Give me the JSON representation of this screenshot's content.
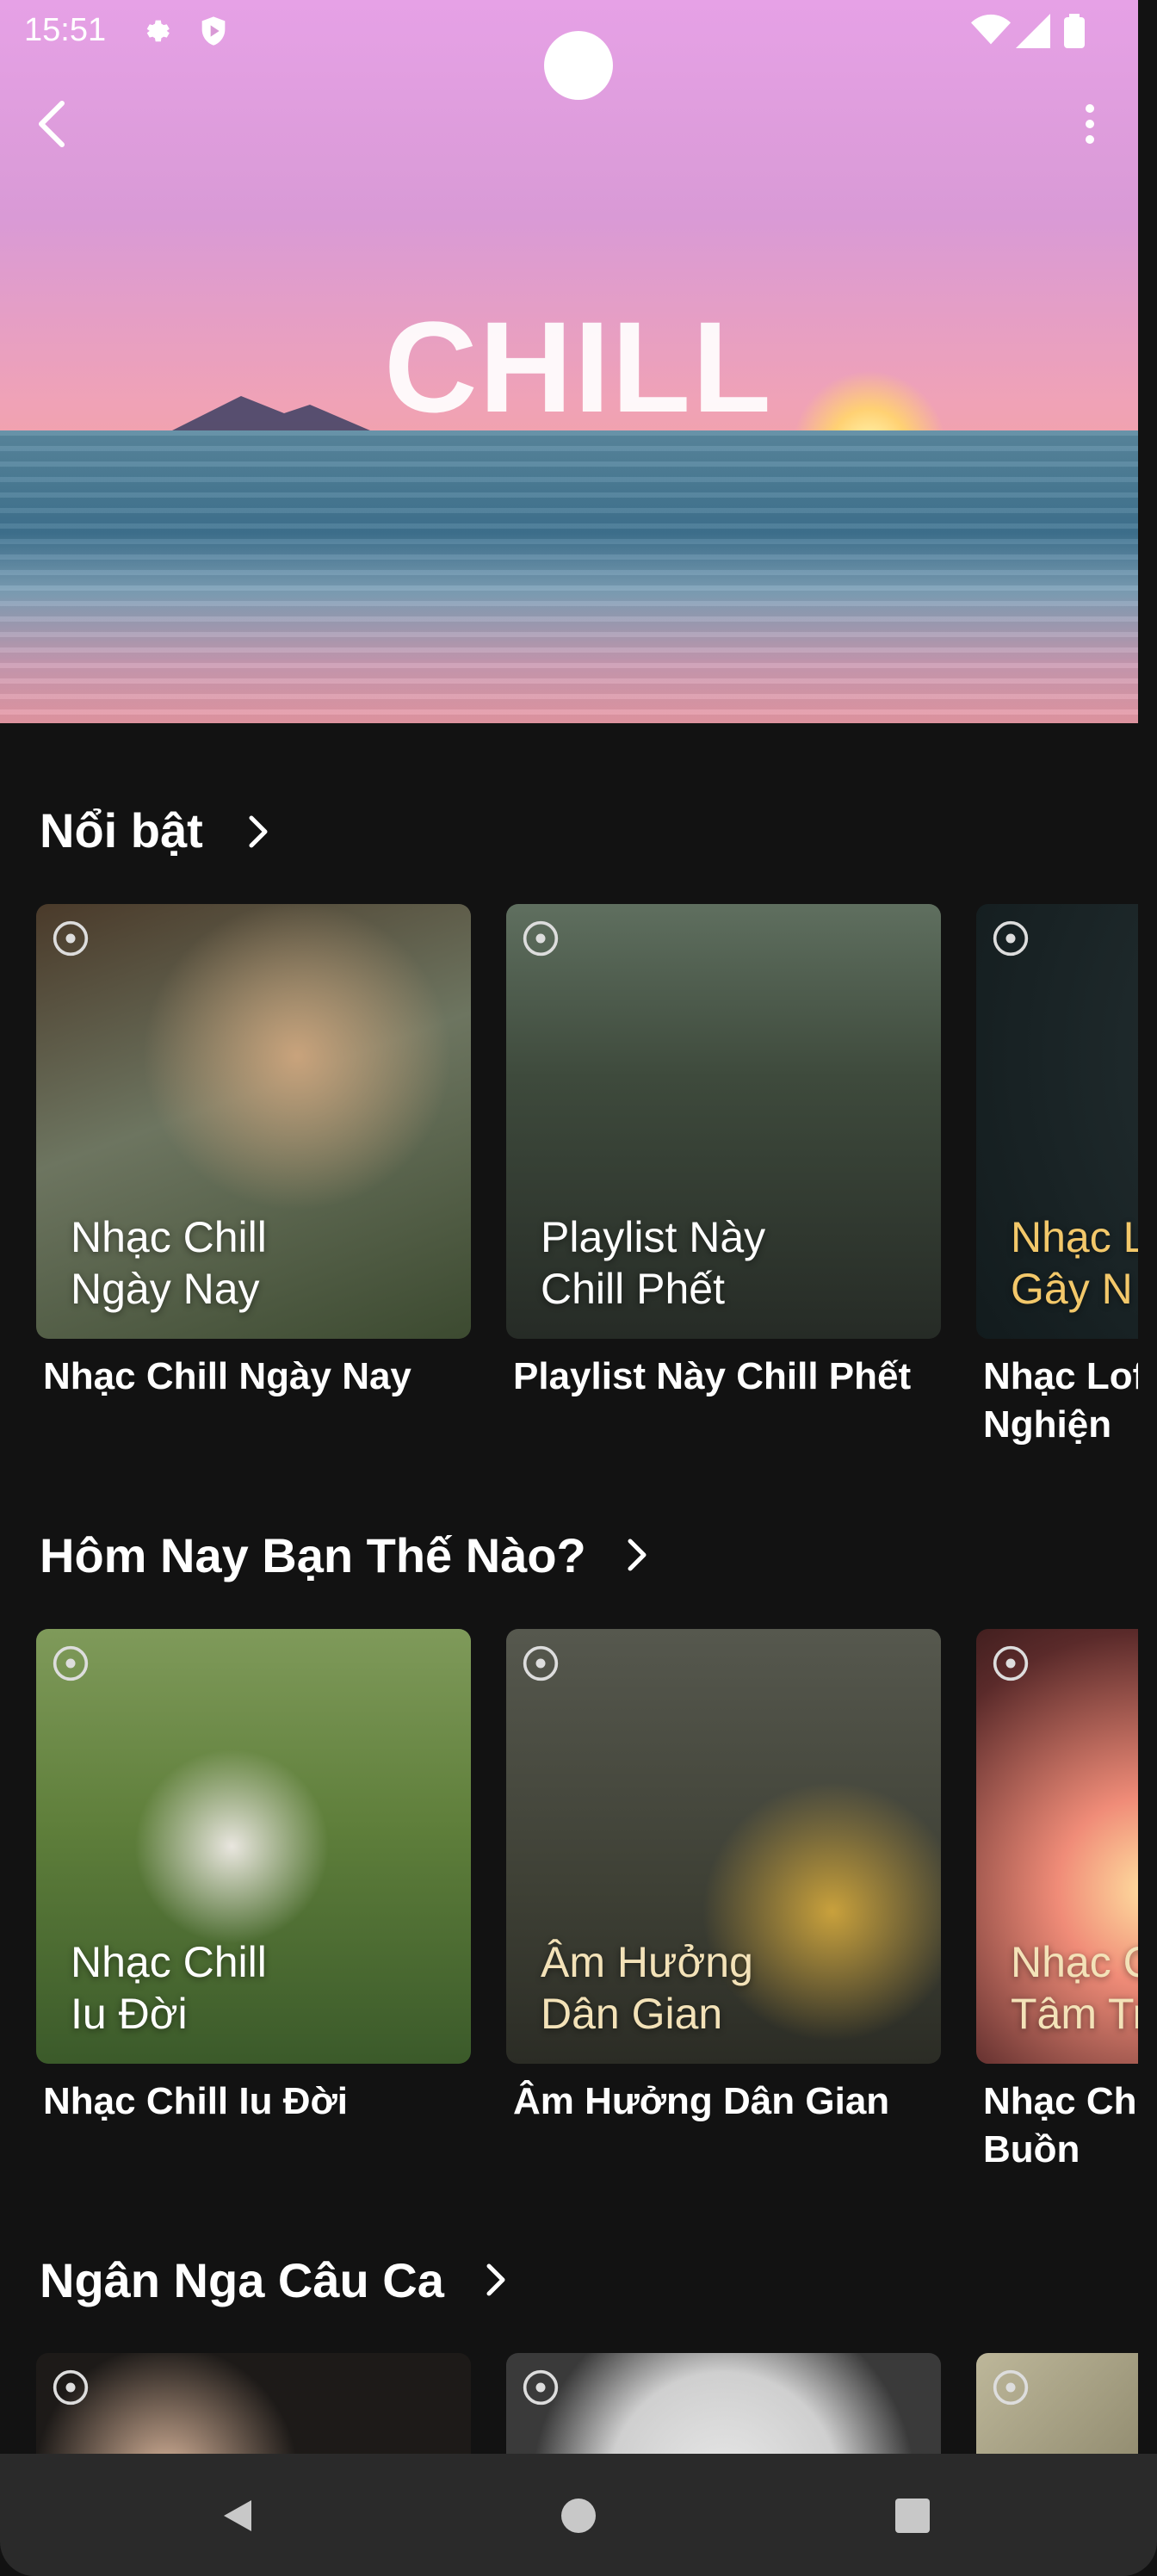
{
  "status_bar": {
    "time": "15:51"
  },
  "hero": {
    "title": "CHILL"
  },
  "sections": [
    {
      "title": "Nổi bật",
      "cards": [
        {
          "title": "Nhạc Chill Ngày Nay",
          "cover_text": [
            "Nhạc Chill",
            "Ngày Nay"
          ]
        },
        {
          "title": "Playlist Này Chill Phết",
          "cover_text": [
            "Playlist Này",
            "Chill Phết"
          ]
        },
        {
          "title": "Nhạc Lof Nghiện",
          "cover_text": [
            "Nhạc L",
            "Gây N"
          ]
        }
      ]
    },
    {
      "title": "Hôm Nay Bạn Thế Nào?",
      "cards": [
        {
          "title": "Nhạc Chill Iu Đời",
          "cover_text": [
            "Nhạc Chill",
            "Iu Đời"
          ]
        },
        {
          "title": "Âm Hưởng Dân Gian",
          "cover_text": [
            "Âm Hưởng",
            "Dân Gian"
          ]
        },
        {
          "title": "Nhạc Chi Buồn",
          "cover_text": [
            "Nhạc C",
            "Tâm Tr"
          ]
        }
      ]
    },
    {
      "title": "Ngân Nga Câu Ca",
      "cards": []
    }
  ],
  "icons": {
    "back": "chevron-left-icon",
    "more": "more-vertical-icon",
    "section_arrow": "chevron-right-icon",
    "disc": "disc-icon",
    "nav_back": "triangle-back-icon",
    "nav_home": "circle-home-icon",
    "nav_recent": "square-recents-icon"
  }
}
